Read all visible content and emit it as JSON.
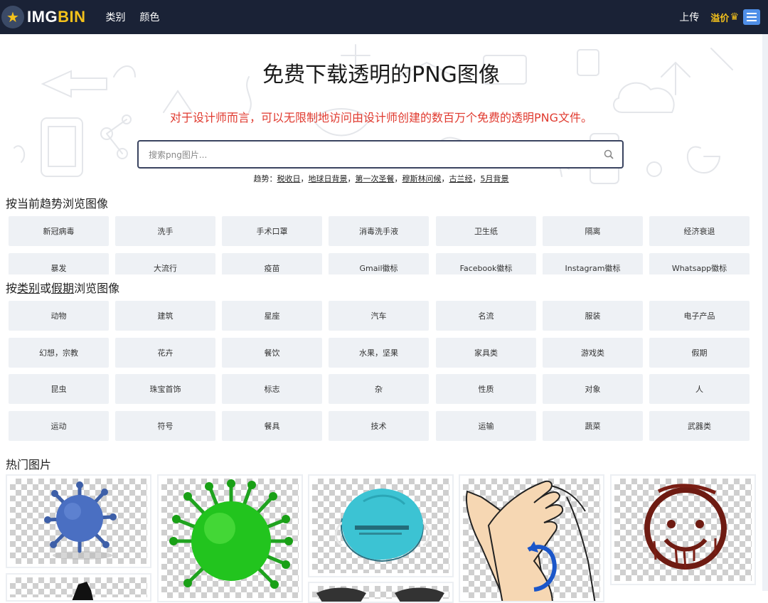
{
  "nav": {
    "logo_img": "IMG",
    "logo_bin": "BIN",
    "links": [
      "类别",
      "颜色"
    ],
    "upload": "上传",
    "premium": "溢价"
  },
  "hero": {
    "title": "免费下载透明的PNG图像",
    "subtitle": "对于设计师而言，可以无限制地访问由设计师创建的数百万个免费的透明PNG文件。",
    "search_placeholder": "搜索png图片...",
    "trending_label": "趋势：",
    "trending_items": [
      "税收日",
      "地球日背景",
      "第一次圣餐",
      "穆斯林问候",
      "古兰经",
      "5月背景"
    ]
  },
  "trends": {
    "title": "按当前趋势浏览图像",
    "items": [
      "新冠病毒",
      "洗手",
      "手术口罩",
      "消毒洗手液",
      "卫生纸",
      "隔离",
      "经济衰退",
      "暴发",
      "大流行",
      "疫苗",
      "Gmail徽标",
      "Facebook徽标",
      "Instagram徽标",
      "Whatsapp徽标"
    ]
  },
  "categories": {
    "title_pre": "按",
    "title_cat": "类别",
    "title_or": "或",
    "title_hol": "假期",
    "title_post": "浏览图像",
    "items": [
      "动物",
      "建筑",
      "星座",
      "汽车",
      "名流",
      "服装",
      "电子产品",
      "幻想，宗教",
      "花卉",
      "餐饮",
      "水果，坚果",
      "家具类",
      "游戏类",
      "假期",
      "昆虫",
      "珠宝首饰",
      "标志",
      "杂",
      "性质",
      "对象",
      "人",
      "运动",
      "符号",
      "餐具",
      "技术",
      "运输",
      "蔬菜",
      "武器类"
    ]
  },
  "hot": {
    "title": "热门图片",
    "cards": [
      {
        "name": "blue-virus"
      },
      {
        "name": "green-virus"
      },
      {
        "name": "n95-mask"
      },
      {
        "name": "hand-washing"
      },
      {
        "name": "smiley-face"
      }
    ]
  },
  "colors": {
    "nav_bg": "#1a2236",
    "brand_yellow": "#f5c21b",
    "subtitle_red": "#e03a2f",
    "chip_bg": "#eef1f5",
    "menu_blue": "#4f8fe8"
  }
}
